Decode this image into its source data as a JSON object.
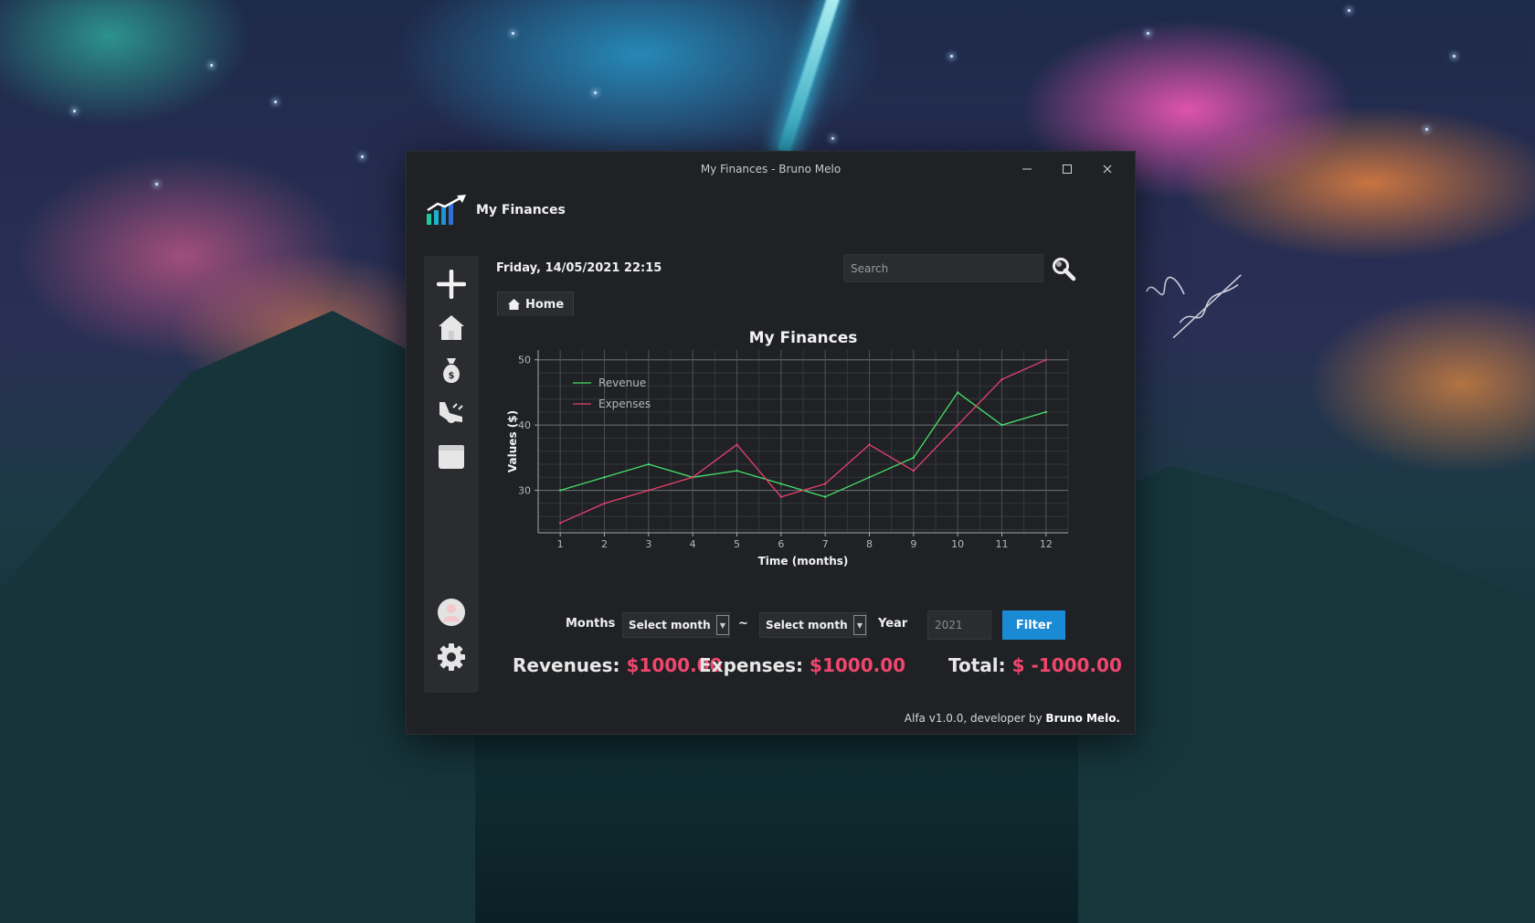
{
  "window": {
    "title": "My Finances - Bruno Melo",
    "minimize_icon": "minimize-icon",
    "maximize_icon": "maximize-icon",
    "close_icon": "close-icon"
  },
  "app": {
    "name": "My Finances",
    "logo_icon": "bar-chart-trend-icon"
  },
  "sidebar": {
    "items": [
      {
        "name": "add",
        "icon": "plus-icon"
      },
      {
        "name": "home",
        "icon": "home-icon"
      },
      {
        "name": "revenue",
        "icon": "money-bag-icon"
      },
      {
        "name": "expenses",
        "icon": "hand-money-icon"
      },
      {
        "name": "calendar",
        "icon": "calendar-icon"
      },
      {
        "name": "profile",
        "icon": "user-avatar-icon"
      },
      {
        "name": "settings",
        "icon": "gear-icon"
      }
    ]
  },
  "header": {
    "datetime": "Friday, 14/05/2021  22:15",
    "search_placeholder": "Search",
    "search_icon": "search-icon"
  },
  "tabs": [
    {
      "label": "Home",
      "icon": "home-icon"
    }
  ],
  "chart_data": {
    "type": "line",
    "title": "My Finances",
    "xlabel": "Time (months)",
    "ylabel": "Values ($)",
    "x": [
      1,
      2,
      3,
      4,
      5,
      6,
      7,
      8,
      9,
      10,
      11,
      12
    ],
    "series": [
      {
        "name": "Revenue",
        "color": "#47e06a",
        "values": [
          30,
          32,
          34,
          32,
          33,
          31,
          29,
          32,
          35,
          45,
          40,
          42
        ]
      },
      {
        "name": "Expenses",
        "color": "#e8406c",
        "values": [
          25,
          28,
          30,
          32,
          37,
          29,
          31,
          37,
          33,
          40,
          47,
          50
        ]
      }
    ],
    "xlim": [
      0.5,
      12.5
    ],
    "ylim": [
      23.5,
      51.5
    ],
    "yticks": [
      30,
      40,
      50
    ],
    "grid": true,
    "legend_position": "top-left"
  },
  "filters": {
    "months_label": "Months",
    "month_from": "Select month",
    "separator": "~",
    "month_to": "Select month",
    "year_label": "Year",
    "year_placeholder": "2021",
    "filter_button": "Filter"
  },
  "summary": {
    "revenues_label": "Revenues:",
    "revenues_value": "$1000.00",
    "expenses_label": "Expenses:",
    "expenses_value": "$1000.00",
    "total_label": "Total:",
    "total_value": "$ -1000.00"
  },
  "footer": {
    "text": "Alfa v1.0.0, developer by ",
    "author": "Bruno Melo."
  },
  "colors": {
    "accent": "#1a8ad4",
    "negative": "#f0466e",
    "window_bg": "#1f2124"
  }
}
